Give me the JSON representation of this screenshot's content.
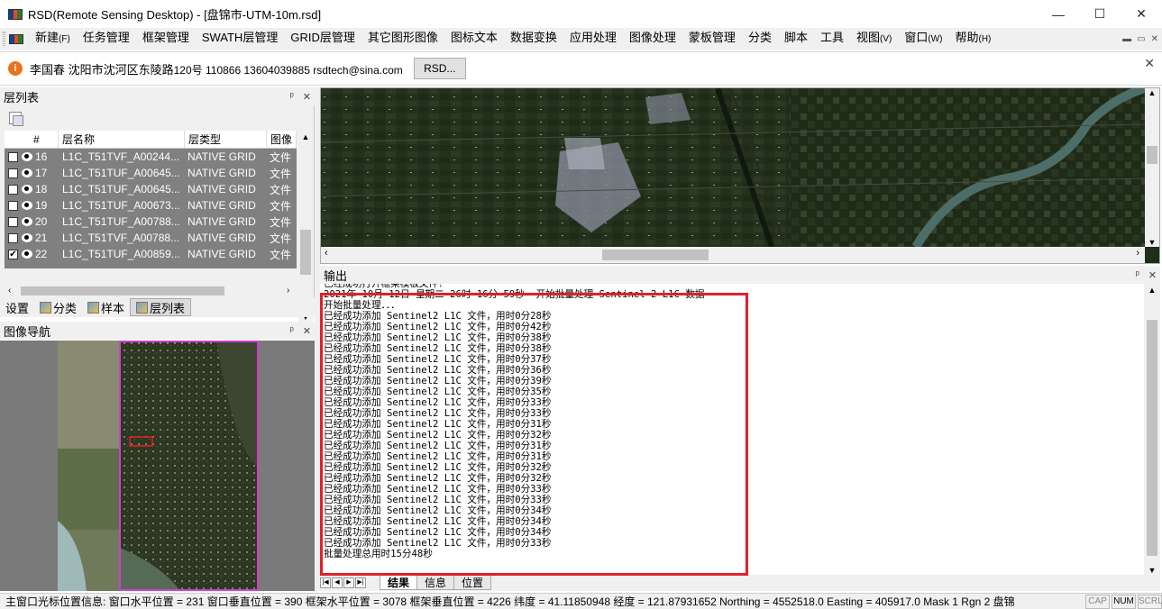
{
  "window": {
    "title": "RSD(Remote Sensing Desktop) - [盘锦市-UTM-10m.rsd]",
    "controls": [
      "—",
      "☐",
      "✕"
    ]
  },
  "menu": {
    "items": [
      {
        "label": "新建",
        "key": "(F)"
      },
      {
        "label": "任务管理",
        "key": ""
      },
      {
        "label": "框架管理",
        "key": ""
      },
      {
        "label": "SWATH层管理",
        "key": ""
      },
      {
        "label": "GRID层管理",
        "key": ""
      },
      {
        "label": "其它图形图像",
        "key": ""
      },
      {
        "label": "图标文本",
        "key": ""
      },
      {
        "label": "数据变换",
        "key": ""
      },
      {
        "label": "应用处理",
        "key": ""
      },
      {
        "label": "图像处理",
        "key": ""
      },
      {
        "label": "蒙板管理",
        "key": ""
      },
      {
        "label": "分类",
        "key": ""
      },
      {
        "label": "脚本",
        "key": ""
      },
      {
        "label": "工具",
        "key": ""
      },
      {
        "label": "视图",
        "key": "(V)"
      },
      {
        "label": "窗口",
        "key": "(W)"
      },
      {
        "label": "帮助",
        "key": "(H)"
      }
    ],
    "mdi_controls": [
      "▬",
      "▭",
      "✕"
    ]
  },
  "infobar": {
    "icon": "i",
    "name_address": "李国春 沈阳市沈河区东陵路",
    "contact": "120号 110866 13604039885 rsdtech@sina.com",
    "button": "RSD...",
    "close": "✕"
  },
  "layer_panel": {
    "title": "层列表",
    "pin": "ᵖ",
    "close": "✕",
    "columns": [
      "#",
      "层名称",
      "层类型",
      "图像"
    ],
    "rows": [
      {
        "checked": false,
        "num": "16",
        "name": "L1C_T51TVF_A00244...",
        "type": "NATIVE GRID",
        "img": "文件"
      },
      {
        "checked": false,
        "num": "17",
        "name": "L1C_T51TUF_A00645...",
        "type": "NATIVE GRID",
        "img": "文件"
      },
      {
        "checked": false,
        "num": "18",
        "name": "L1C_T51TUF_A00645...",
        "type": "NATIVE GRID",
        "img": "文件"
      },
      {
        "checked": false,
        "num": "19",
        "name": "L1C_T51TUF_A00673...",
        "type": "NATIVE GRID",
        "img": "文件"
      },
      {
        "checked": false,
        "num": "20",
        "name": "L1C_T51TUF_A00788...",
        "type": "NATIVE GRID",
        "img": "文件"
      },
      {
        "checked": false,
        "num": "21",
        "name": "L1C_T51TVF_A00788...",
        "type": "NATIVE GRID",
        "img": "文件"
      },
      {
        "checked": true,
        "num": "22",
        "name": "L1C_T51TUF_A00859...",
        "type": "NATIVE GRID",
        "img": "文件"
      }
    ],
    "tabs": [
      "设置",
      "分类",
      "样本",
      "层列表"
    ]
  },
  "nav_panel": {
    "title": "图像导航"
  },
  "output_panel": {
    "title": "输出",
    "lines": [
      "已经成功打开框架模板文件！",
      "2021年 10月 12日 星期二 26时 16分 59秒  开始批量处理 Sentinel-2 L1C 数据",
      "开始批量处理．．．",
      "已经成功添加 Sentinel2 L1C 文件，用时0分28秒",
      "已经成功添加 Sentinel2 L1C 文件，用时0分42秒",
      "已经成功添加 Sentinel2 L1C 文件，用时0分38秒",
      "已经成功添加 Sentinel2 L1C 文件，用时0分38秒",
      "已经成功添加 Sentinel2 L1C 文件，用时0分37秒",
      "已经成功添加 Sentinel2 L1C 文件，用时0分36秒",
      "已经成功添加 Sentinel2 L1C 文件，用时0分39秒",
      "已经成功添加 Sentinel2 L1C 文件，用时0分35秒",
      "已经成功添加 Sentinel2 L1C 文件，用时0分33秒",
      "已经成功添加 Sentinel2 L1C 文件，用时0分33秒",
      "已经成功添加 Sentinel2 L1C 文件，用时0分31秒",
      "已经成功添加 Sentinel2 L1C 文件，用时0分32秒",
      "已经成功添加 Sentinel2 L1C 文件，用时0分31秒",
      "已经成功添加 Sentinel2 L1C 文件，用时0分31秒",
      "已经成功添加 Sentinel2 L1C 文件，用时0分32秒",
      "已经成功添加 Sentinel2 L1C 文件，用时0分32秒",
      "已经成功添加 Sentinel2 L1C 文件，用时0分33秒",
      "已经成功添加 Sentinel2 L1C 文件，用时0分33秒",
      "已经成功添加 Sentinel2 L1C 文件，用时0分34秒",
      "已经成功添加 Sentinel2 L1C 文件，用时0分34秒",
      "已经成功添加 Sentinel2 L1C 文件，用时0分34秒",
      "已经成功添加 Sentinel2 L1C 文件，用时0分33秒",
      "批量处理总用时15分48秒"
    ],
    "tabs": [
      "结果",
      "信息",
      "位置"
    ],
    "nav_buttons": [
      "|◀",
      "◀",
      "▶",
      "▶|"
    ]
  },
  "statusbar": {
    "text": "主窗口光标位置信息:  窗口水平位置 = 231 窗口垂直位置 = 390 框架水平位置 = 3078 框架垂直位置 = 4226 纬度 = 41.11850948 经度 = 121.87931652 Northing = 4552518.0 Easting = 405917.0 Mask  1 Rgn  2 盘锦",
    "indicators": [
      {
        "label": "CAP",
        "on": false
      },
      {
        "label": "NUM",
        "on": true
      },
      {
        "label": "SCRL",
        "on": false
      }
    ]
  },
  "colors": {
    "highlight": "#e0202a",
    "layer_rows_bg": "#808080"
  }
}
